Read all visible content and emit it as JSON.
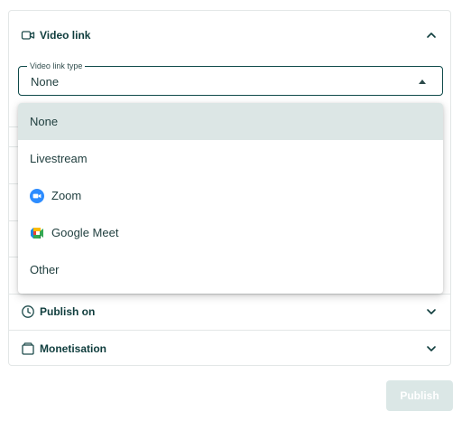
{
  "video_link": {
    "title": "Video link",
    "icon": "video-camera-icon",
    "expanded": true,
    "select": {
      "legend": "Video link type",
      "value": "None"
    },
    "options": [
      {
        "label": "None",
        "icon": null,
        "selected": true
      },
      {
        "label": "Livestream",
        "icon": null,
        "selected": false
      },
      {
        "label": "Zoom",
        "icon": "zoom-icon",
        "selected": false
      },
      {
        "label": "Google Meet",
        "icon": "google-meet-icon",
        "selected": false
      },
      {
        "label": "Other",
        "icon": null,
        "selected": false
      }
    ]
  },
  "publish_on": {
    "title": "Publish on",
    "icon": "clock-icon"
  },
  "monetisation": {
    "title": "Monetisation",
    "icon": "wallet-icon"
  },
  "actions": {
    "publish_label": "Publish"
  },
  "colors": {
    "text_primary": "#0f3d3d",
    "selected_option_bg": "#dce6e5",
    "publish_disabled_bg": "#dbe7e6",
    "zoom_blue": "#2d8cff"
  }
}
